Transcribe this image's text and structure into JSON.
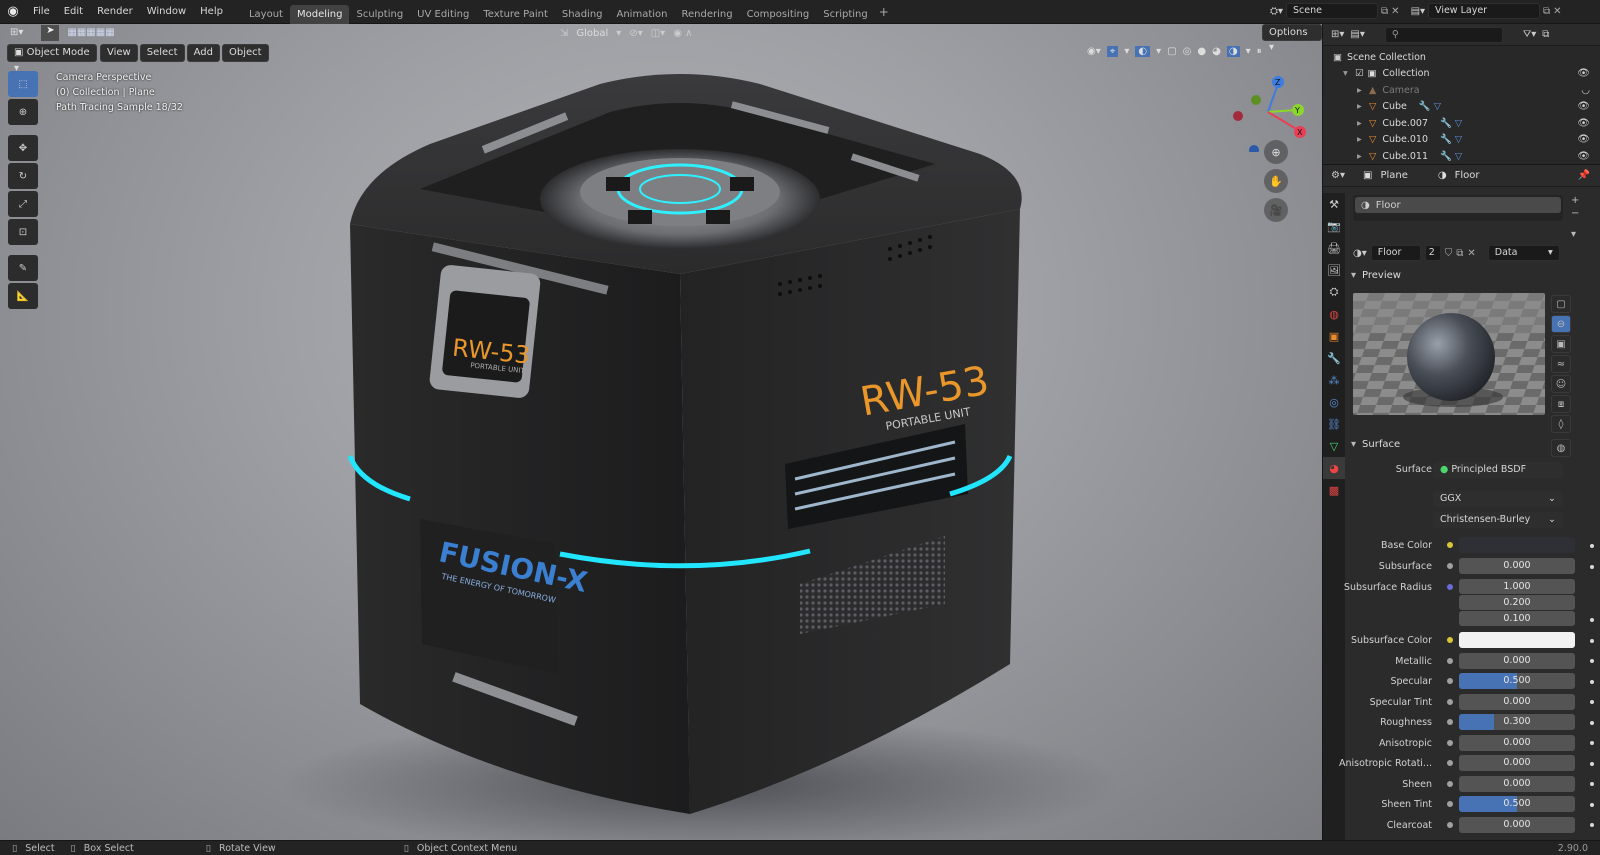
{
  "topbar": {
    "menus": [
      "File",
      "Edit",
      "Render",
      "Window",
      "Help"
    ],
    "workspaces": [
      "Layout",
      "Modeling",
      "Sculpting",
      "UV Editing",
      "Texture Paint",
      "Shading",
      "Animation",
      "Rendering",
      "Compositing",
      "Scripting"
    ],
    "active_workspace": "Modeling",
    "add_tab": "+",
    "scene": "Scene",
    "view_layer": "View Layer"
  },
  "viewport": {
    "mode": "Object Mode",
    "menus": [
      "View",
      "Select",
      "Add",
      "Object"
    ],
    "orientation": "Global",
    "options": "Options",
    "overlay_lines": [
      "Camera Perspective",
      "(0) Collection | Plane",
      "Path Tracing Sample 18/32"
    ],
    "gizmo_axes": {
      "z": "Z",
      "y": "Y",
      "x": "X"
    },
    "colors": {
      "accent": "#4772b3",
      "glow": "#22e5ff",
      "orange": "#e9962b",
      "blue_logo": "#3a7fd0"
    },
    "decals": {
      "top_badge": "RW-53",
      "top_badge_sub": "PORTABLE UNIT",
      "side": "RW-53",
      "side_sub": "PORTABLE UNIT",
      "brand": "FUSION-X",
      "brand_sub": "THE ENERGY OF TOMORROW"
    }
  },
  "outliner": {
    "root": "Scene Collection",
    "items": [
      {
        "name": "Collection",
        "level": 1
      },
      {
        "name": "Camera",
        "level": 2,
        "dim": true
      },
      {
        "name": "Cube",
        "level": 2
      },
      {
        "name": "Cube.007",
        "level": 2
      },
      {
        "name": "Cube.010",
        "level": 2
      },
      {
        "name": "Cube.011",
        "level": 2
      }
    ]
  },
  "properties": {
    "breadcrumb_object": "Plane",
    "breadcrumb_material": "Floor",
    "slot": "Floor",
    "material_name": "Floor",
    "users": "2",
    "link": "Data",
    "preview_label": "Preview",
    "surface_label": "Surface",
    "surface_shader_label": "Surface",
    "surface_shader": "Principled BSDF",
    "distribution": "GGX",
    "subsurface_method": "Christensen-Burley",
    "fields": [
      {
        "label": "Base Color",
        "type": "color",
        "color": "#2f3036",
        "dot": "#d8c53a"
      },
      {
        "label": "Subsurface",
        "type": "value",
        "value": "0.000",
        "fill": 0
      },
      {
        "label": "Subsurface Radius",
        "type": "vector",
        "values": [
          "1.000",
          "0.200",
          "0.100"
        ],
        "dot": "#6a6ad8"
      },
      {
        "label": "Subsurface Color",
        "type": "color",
        "color": "#f2f2f2",
        "dot": "#d8c53a"
      },
      {
        "label": "Metallic",
        "type": "value",
        "value": "0.000",
        "fill": 0
      },
      {
        "label": "Specular",
        "type": "value",
        "value": "0.500",
        "fill": 0.5
      },
      {
        "label": "Specular Tint",
        "type": "value",
        "value": "0.000",
        "fill": 0
      },
      {
        "label": "Roughness",
        "type": "value",
        "value": "0.300",
        "fill": 0.3
      },
      {
        "label": "Anisotropic",
        "type": "value",
        "value": "0.000",
        "fill": 0
      },
      {
        "label": "Anisotropic Rotati...",
        "type": "value",
        "value": "0.000",
        "fill": 0
      },
      {
        "label": "Sheen",
        "type": "value",
        "value": "0.000",
        "fill": 0
      },
      {
        "label": "Sheen Tint",
        "type": "value",
        "value": "0.500",
        "fill": 0.5
      },
      {
        "label": "Clearcoat",
        "type": "value",
        "value": "0.000",
        "fill": 0
      }
    ]
  },
  "statusbar": {
    "select": "Select",
    "box_select": "Box Select",
    "rotate": "Rotate View",
    "context_menu": "Object Context Menu",
    "version": "2.90.0"
  }
}
